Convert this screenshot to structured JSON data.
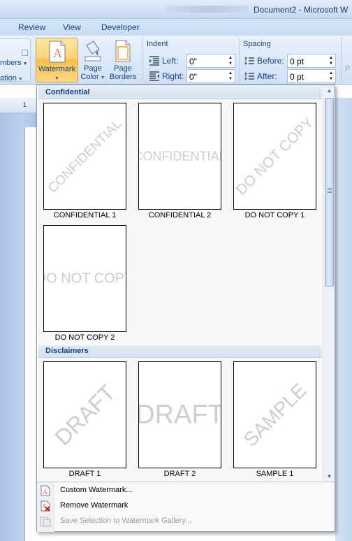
{
  "window": {
    "title": "Document2 - Microsoft W"
  },
  "tabs": [
    "Review",
    "View",
    "Developer"
  ],
  "ribbon": {
    "left_partial": [
      "mbers",
      "ation"
    ],
    "watermark_button": {
      "label": "Watermark"
    },
    "page_color_button": {
      "line1": "Page",
      "line2": "Color"
    },
    "page_borders_button": {
      "line1": "Page",
      "line2": "Borders"
    },
    "indent": {
      "title": "Indent",
      "left_label": "Left:",
      "left_value": "0\"",
      "right_label": "Right:",
      "right_value": "0\""
    },
    "spacing": {
      "title": "Spacing",
      "before_label": "Before:",
      "before_value": "0 pt",
      "after_label": "After:",
      "after_value": "0 pt"
    },
    "far_right_partial": "P"
  },
  "ruler": {
    "mark": "1"
  },
  "gallery": {
    "sections": [
      {
        "title": "Confidential",
        "items": [
          {
            "caption": "CONFIDENTIAL 1",
            "text": "CONFIDENTIAL",
            "style": "diagonal"
          },
          {
            "caption": "CONFIDENTIAL 2",
            "text": "CONFIDENTIAL",
            "style": "horizontal"
          },
          {
            "caption": "DO NOT COPY 1",
            "text": "DO NOT COPY",
            "style": "diagonal"
          },
          {
            "caption": "DO NOT COPY 2",
            "text": "DO NOT COPY",
            "style": "horizontal"
          }
        ]
      },
      {
        "title": "Disclaimers",
        "items": [
          {
            "caption": "DRAFT 1",
            "text": "DRAFT",
            "style": "diagonal"
          },
          {
            "caption": "DRAFT 2",
            "text": "DRAFT",
            "style": "horizontal"
          },
          {
            "caption": "SAMPLE 1",
            "text": "SAMPLE",
            "style": "diagonal"
          }
        ]
      }
    ],
    "menu": [
      {
        "label": "Custom Watermark...",
        "enabled": true,
        "icon": "custom-watermark-icon"
      },
      {
        "label": "Remove Watermark",
        "enabled": true,
        "icon": "remove-watermark-icon"
      },
      {
        "label": "Save Selection to Watermark Gallery...",
        "enabled": false,
        "icon": "save-to-gallery-icon"
      }
    ]
  },
  "colors": {
    "ribbon_text": "#15428b",
    "active_button": "#f8c04a",
    "watermark_gray": "#cdcdcd",
    "gallery_header": "#d5e2f0"
  }
}
